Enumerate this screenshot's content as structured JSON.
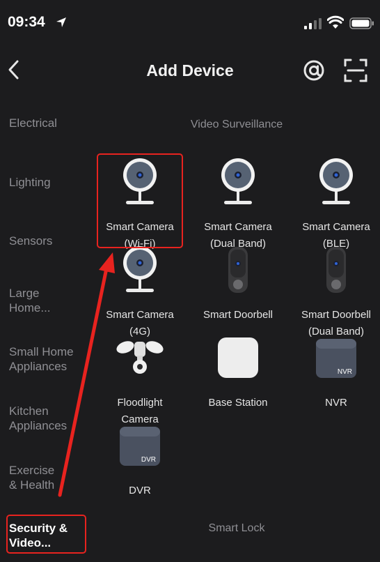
{
  "status_bar": {
    "time": "09:34"
  },
  "header": {
    "title": "Add Device"
  },
  "sidebar": {
    "items": [
      {
        "label": "Electrical"
      },
      {
        "label": "Lighting"
      },
      {
        "label": "Sensors"
      },
      {
        "label": "Large Home..."
      },
      {
        "label": "Small Home Appliances"
      },
      {
        "label": "Kitchen Appliances"
      },
      {
        "label": "Exercise & Health"
      },
      {
        "label": "Security & Video..."
      }
    ],
    "active_index": 7
  },
  "main": {
    "section_title": "Video Surveillance",
    "devices": [
      {
        "line1": "Smart Camera",
        "line2": "(Wi-Fi)",
        "icon": "camera-icon"
      },
      {
        "line1": "Smart Camera",
        "line2": "(Dual Band)",
        "icon": "camera-icon"
      },
      {
        "line1": "Smart Camera",
        "line2": "(BLE)",
        "icon": "camera-icon"
      },
      {
        "line1": "Smart Camera",
        "line2": "(4G)",
        "icon": "camera-icon"
      },
      {
        "line1": "Smart Doorbell",
        "line2": "",
        "icon": "doorbell-icon"
      },
      {
        "line1": "Smart Doorbell",
        "line2": "(Dual Band)",
        "icon": "doorbell-icon"
      },
      {
        "line1": "Floodlight",
        "line2": "Camera",
        "icon": "floodlight-icon"
      },
      {
        "line1": "Base Station",
        "line2": "",
        "icon": "base-station-icon"
      },
      {
        "line1": "NVR",
        "line2": "",
        "icon": "nvr-icon",
        "badge": "NVR"
      },
      {
        "line1": "DVR",
        "line2": "",
        "icon": "dvr-icon",
        "badge": "DVR"
      }
    ],
    "next_section_title": "Smart Lock"
  },
  "colors": {
    "background": "#1c1c1e",
    "highlight": "#e8231f",
    "muted_text": "#8f8f94"
  }
}
